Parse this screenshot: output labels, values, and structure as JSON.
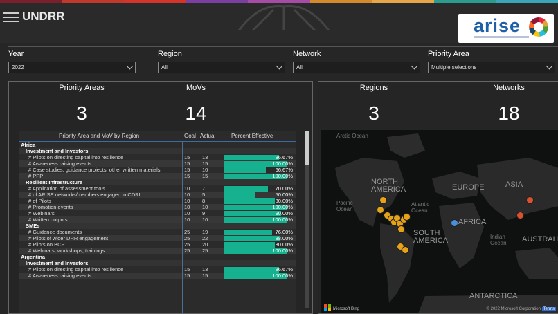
{
  "header": {
    "brand": "UNDRR",
    "logo_text": "arise",
    "stripe_colors": [
      "#7a1f2b",
      "#c0392b",
      "#d4342a",
      "#7b3fa1",
      "#a64ca6",
      "#d58a2c",
      "#e8a64a",
      "#2a9d8f",
      "#3aa6b9"
    ]
  },
  "filters": [
    {
      "label": "Year",
      "value": "2022"
    },
    {
      "label": "Region",
      "value": "All"
    },
    {
      "label": "Network",
      "value": "All"
    },
    {
      "label": "Priority Area",
      "value": "Multiple selections"
    }
  ],
  "cards": {
    "priority_areas": {
      "label": "Priority Areas",
      "value": "3"
    },
    "movs": {
      "label": "MoVs",
      "value": "14"
    },
    "regions": {
      "label": "Regions",
      "value": "3"
    },
    "networks": {
      "label": "Networks",
      "value": "18"
    }
  },
  "table": {
    "headers": {
      "name": "Priority Area and MoV by Region",
      "goal": "Goal",
      "actual": "Actual",
      "pct": "Percent Effective"
    },
    "rows": [
      {
        "type": "region",
        "label": "Africa"
      },
      {
        "type": "area",
        "label": "Investment and Investors"
      },
      {
        "type": "metric",
        "label": "# Pilots on directing capital into resilience",
        "goal": "15",
        "actual": "13",
        "pct": "86.67%",
        "frac": 0.8667
      },
      {
        "type": "metric",
        "label": "# Awareness raising events",
        "goal": "15",
        "actual": "15",
        "pct": "100.00%",
        "frac": 1.0
      },
      {
        "type": "metric",
        "label": "# Case studies, guidance projects, other written materials",
        "goal": "15",
        "actual": "10",
        "pct": "66.67%",
        "frac": 0.6667
      },
      {
        "type": "metric",
        "label": "# PPP",
        "goal": "15",
        "actual": "15",
        "pct": "100.00%",
        "frac": 1.0
      },
      {
        "type": "area",
        "label": "Resilient Infrastructure"
      },
      {
        "type": "metric",
        "label": "# Application of assessment tools",
        "goal": "10",
        "actual": "7",
        "pct": "70.00%",
        "frac": 0.7
      },
      {
        "type": "metric",
        "label": "# of ARISE networks/members engaged in CDRI",
        "goal": "10",
        "actual": "5",
        "pct": "50.00%",
        "frac": 0.5
      },
      {
        "type": "metric",
        "label": "# of Pilots",
        "goal": "10",
        "actual": "8",
        "pct": "80.00%",
        "frac": 0.8
      },
      {
        "type": "metric",
        "label": "# Promotion events",
        "goal": "10",
        "actual": "10",
        "pct": "100.00%",
        "frac": 1.0
      },
      {
        "type": "metric",
        "label": "# Webinars",
        "goal": "10",
        "actual": "9",
        "pct": "90.00%",
        "frac": 0.9
      },
      {
        "type": "metric",
        "label": "# Written outputs",
        "goal": "10",
        "actual": "10",
        "pct": "100.00%",
        "frac": 1.0
      },
      {
        "type": "area",
        "label": "SMEs"
      },
      {
        "type": "metric",
        "label": "# Guidance documents",
        "goal": "25",
        "actual": "19",
        "pct": "76.00%",
        "frac": 0.76
      },
      {
        "type": "metric",
        "label": "# Pilots of wider DRR engagement",
        "goal": "25",
        "actual": "22",
        "pct": "88.00%",
        "frac": 0.88
      },
      {
        "type": "metric",
        "label": "# Pilots on BCP",
        "goal": "25",
        "actual": "20",
        "pct": "80.00%",
        "frac": 0.8
      },
      {
        "type": "metric",
        "label": "# Webinars, workshops, trainings",
        "goal": "25",
        "actual": "25",
        "pct": "100.00%",
        "frac": 1.0
      },
      {
        "type": "region",
        "label": "Argentina"
      },
      {
        "type": "area",
        "label": "Investment and Investors"
      },
      {
        "type": "metric",
        "label": "# Pilots on directing capital into resilience",
        "goal": "15",
        "actual": "13",
        "pct": "86.67%",
        "frac": 0.8667
      },
      {
        "type": "metric",
        "label": "# Awareness raising events",
        "goal": "15",
        "actual": "15",
        "pct": "100.00%",
        "frac": 1.0
      }
    ]
  },
  "map": {
    "labels": {
      "arctic": "Arctic Ocean",
      "north_america": "NORTH AMERICA",
      "europe": "EUROPE",
      "asia": "ASIA",
      "pacific": "Pacific Ocean",
      "atlantic": "Atlantic Ocean",
      "africa": "AFRICA",
      "south_america": "SOUTH AMERICA",
      "indian": "Indian Ocean",
      "australia": "AUSTRALI",
      "antarctica": "ANTARCTICA"
    },
    "credit": "Microsoft Bing",
    "copyright": "© 2022 Microsoft Corporation",
    "terms": "Terms",
    "dot_colors": {
      "orange": "#e6a317",
      "red": "#d9522b",
      "blue": "#4a90d9"
    }
  }
}
